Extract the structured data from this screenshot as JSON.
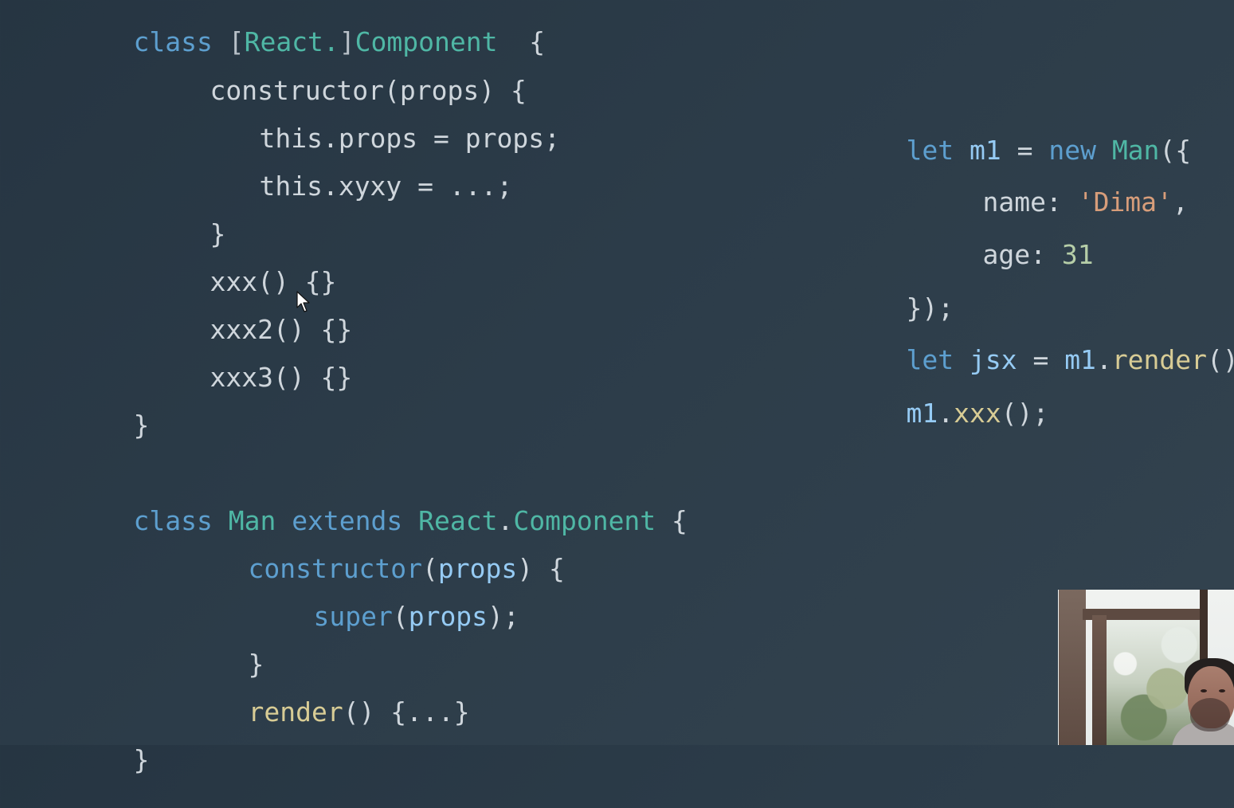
{
  "screen": {
    "background": "#2d3d49",
    "code_colors": {
      "keyword": "#5d9fcf",
      "type": "#4fb7a5",
      "function": "#d8cc95",
      "variable": "#96cbf4",
      "string": "#d79d7a",
      "number": "#b6cea8",
      "text": "#cfd6dc"
    },
    "cursor_icon": "mouse-pointer-icon",
    "video_overlay_icon": "webcam-person-image"
  },
  "left_code": {
    "line1": {
      "part1": "class ",
      "part2": "[",
      "part3": "React.",
      "part4": "]",
      "part5": "Component",
      "part6": "  {"
    },
    "line2": {
      "part1": "constructor(props) {"
    },
    "line3": {
      "part1": "this.props = props;"
    },
    "line4": {
      "part1": "this.xyxy = ...;"
    },
    "line5": {
      "part1": "}"
    },
    "line6": {
      "part1": "xxx() {}"
    },
    "line7": {
      "part1": "xxx2() {}"
    },
    "line8": {
      "part1": "xxx3() {}"
    },
    "line9": {
      "part1": "}"
    },
    "line10": {
      "part1": "class ",
      "part2": "Man ",
      "part3": "extends ",
      "part4": "React",
      "part5": ".",
      "part6": "Component",
      "part7": " {"
    },
    "line11": {
      "part1": "constructor",
      "part2": "(",
      "part3": "props",
      "part4": ") {"
    },
    "line12": {
      "part1": "super",
      "part2": "(",
      "part3": "props",
      "part4": ");"
    },
    "line13": {
      "part1": "}"
    },
    "line14": {
      "part1": "render",
      "part2": "() {...}"
    },
    "line15": {
      "part1": "}"
    }
  },
  "right_code": {
    "line1": {
      "part1": "let ",
      "part2": "m1",
      "part3": " = ",
      "part4": "new ",
      "part5": "Man",
      "part6": "({"
    },
    "line2": {
      "part1": "name: ",
      "part2": "'Dima'",
      "part3": ","
    },
    "line3": {
      "part1": "age: ",
      "part2": "31"
    },
    "line4": {
      "part1": "});"
    },
    "line5": {
      "part1": "let ",
      "part2": "jsx",
      "part3": " = ",
      "part4": "m1",
      "part5": ".",
      "part6": "render",
      "part7": "();"
    },
    "line6": {
      "part1": "m1",
      "part2": ".",
      "part3": "xxx",
      "part4": "();"
    }
  }
}
